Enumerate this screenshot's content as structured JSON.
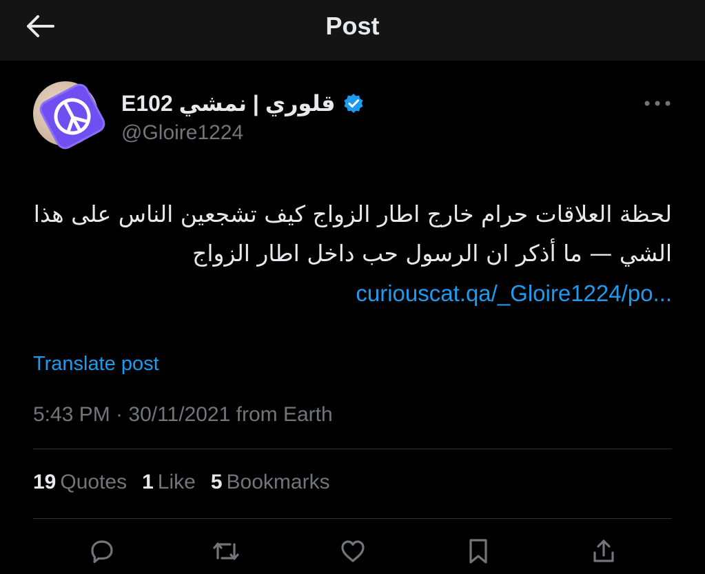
{
  "header": {
    "title": "Post",
    "back_icon": "arrow-left-icon"
  },
  "author": {
    "display_name": "قلوري | نمشي E102",
    "handle": "@Gloire1224",
    "verified": true,
    "verified_color": "#1d9bf0",
    "avatar_icon": "peace-sign-icon",
    "avatar_badge_color": "#6f4ef2"
  },
  "more_icon": "more-horizontal-icon",
  "post": {
    "text": "لحظة العلاقات حرام خارج اطار الزواج كيف تشجعين الناس على هذا الشي — ما أذكر ان الرسول حب داخل اطار الزواج",
    "link": "curiouscat.qa/_Gloire1224/po...",
    "translate_label": "Translate post",
    "timestamp": "5:43 PM · 30/11/2021 from Earth"
  },
  "stats": [
    {
      "count": "19",
      "label": "Quotes"
    },
    {
      "count": "1",
      "label": "Like"
    },
    {
      "count": "5",
      "label": "Bookmarks"
    }
  ],
  "actions": [
    {
      "icon": "reply-icon"
    },
    {
      "icon": "repost-icon"
    },
    {
      "icon": "like-icon"
    },
    {
      "icon": "bookmark-icon"
    },
    {
      "icon": "share-icon"
    }
  ],
  "colors": {
    "background": "#000000",
    "header_background": "#141414",
    "text_primary": "#e7e9ea",
    "text_secondary": "#71767b",
    "link": "#1d9bf0",
    "divider": "#2f3336"
  }
}
